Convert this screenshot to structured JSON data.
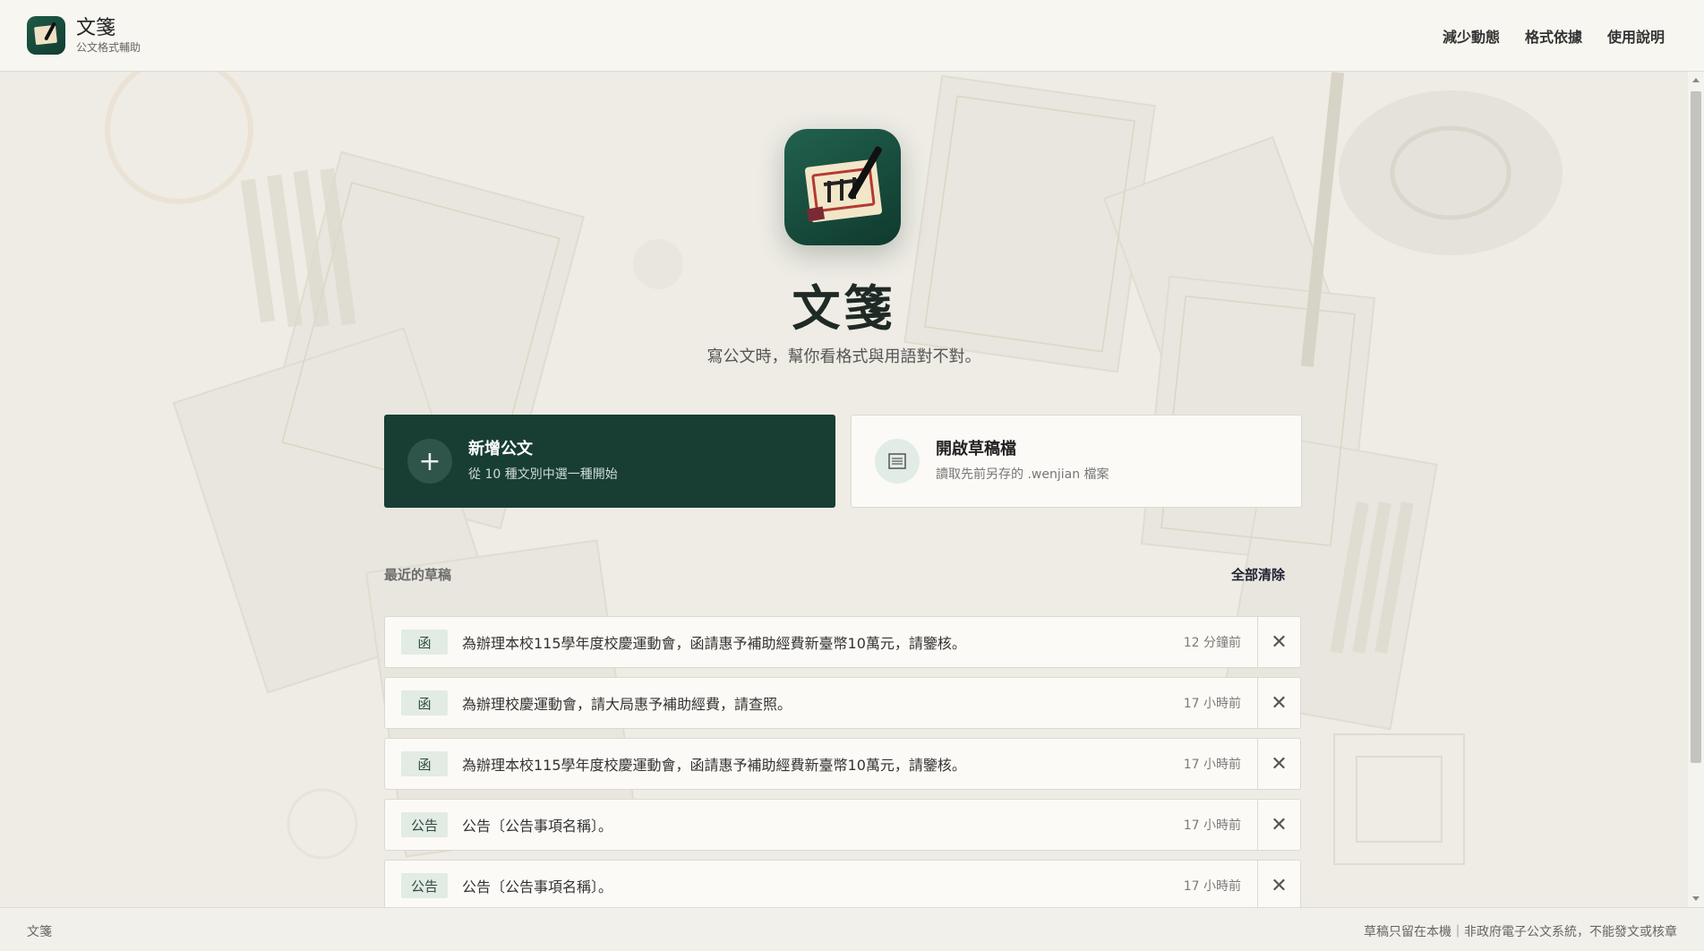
{
  "header": {
    "brand_name": "文箋",
    "brand_sub": "公文格式輔助",
    "nav": [
      "減少動態",
      "格式依據",
      "使用說明"
    ]
  },
  "hero": {
    "title": "文箋",
    "subtitle": "寫公文時，幫你看格式與用語對不對。"
  },
  "actions": {
    "new": {
      "icon": "plus-icon",
      "title": "新增公文",
      "desc": "從 10 種文別中選一種開始"
    },
    "open": {
      "icon": "document-lines-icon",
      "title": "開啟草稿檔",
      "desc": "讀取先前另存的 .wenjian 檔案"
    }
  },
  "recent": {
    "label": "最近的草稿",
    "clear_all": "全部清除",
    "items": [
      {
        "tag": "函",
        "title": "為辦理本校115學年度校慶運動會，函請惠予補助經費新臺幣10萬元，請鑒核。",
        "time": "12 分鐘前"
      },
      {
        "tag": "函",
        "title": "為辦理校慶運動會，請大局惠予補助經費，請查照。",
        "time": "17 小時前"
      },
      {
        "tag": "函",
        "title": "為辦理本校115學年度校慶運動會，函請惠予補助經費新臺幣10萬元，請鑒核。",
        "time": "17 小時前"
      },
      {
        "tag": "公告",
        "title": "公告〔公告事項名稱〕。",
        "time": "17 小時前"
      },
      {
        "tag": "公告",
        "title": "公告〔公告事項名稱〕。",
        "time": "17 小時前"
      }
    ]
  },
  "footer": {
    "left": "文箋",
    "right": "草稿只留在本機｜非政府電子公文系統，不能發文或核章"
  },
  "colors": {
    "accent": "#183d33",
    "background": "#eeece5",
    "tag_bg": "#e2ebe4"
  }
}
